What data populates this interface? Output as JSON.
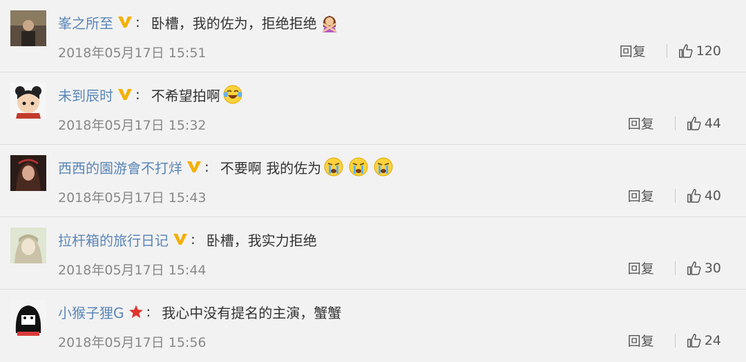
{
  "comments": [
    {
      "username": "峯之所至",
      "badge": "v-verified",
      "text": "卧槽，我的佐为，拒绝拒绝",
      "emoji": [
        "woman-gesturing-no"
      ],
      "date": "2018年05月17日 15:51",
      "reply_label": "回复",
      "likes": "120"
    },
    {
      "username": "未到辰时",
      "badge": "v-verified",
      "text": "不希望拍啊",
      "emoji": [
        "tears-of-joy-face"
      ],
      "date": "2018年05月17日 15:32",
      "reply_label": "回复",
      "likes": "44"
    },
    {
      "username": "西西的園游會不打烊",
      "badge": "v-verified",
      "text": "不要啊 我的佐为",
      "emoji": [
        "crying-face",
        "crying-face",
        "crying-face"
      ],
      "date": "2018年05月17日 15:43",
      "reply_label": "回复",
      "likes": "40"
    },
    {
      "username": "拉杆箱的旅行日记",
      "badge": "v-verified",
      "text": "卧槽，我实力拒绝",
      "emoji": [],
      "date": "2018年05月17日 15:44",
      "reply_label": "回复",
      "likes": "30"
    },
    {
      "username": "小猴子狸G",
      "badge": "red-star",
      "text": "我心中没有提名的主演，蟹蟹",
      "emoji": [],
      "date": "2018年05月17日 15:56",
      "reply_label": "回复",
      "likes": "24"
    }
  ],
  "colors": {
    "username": "#5a86b8",
    "badge_gold": "#f4b000",
    "badge_red": "#e0342f",
    "date": "#888888",
    "background": "#f2f2f2"
  }
}
